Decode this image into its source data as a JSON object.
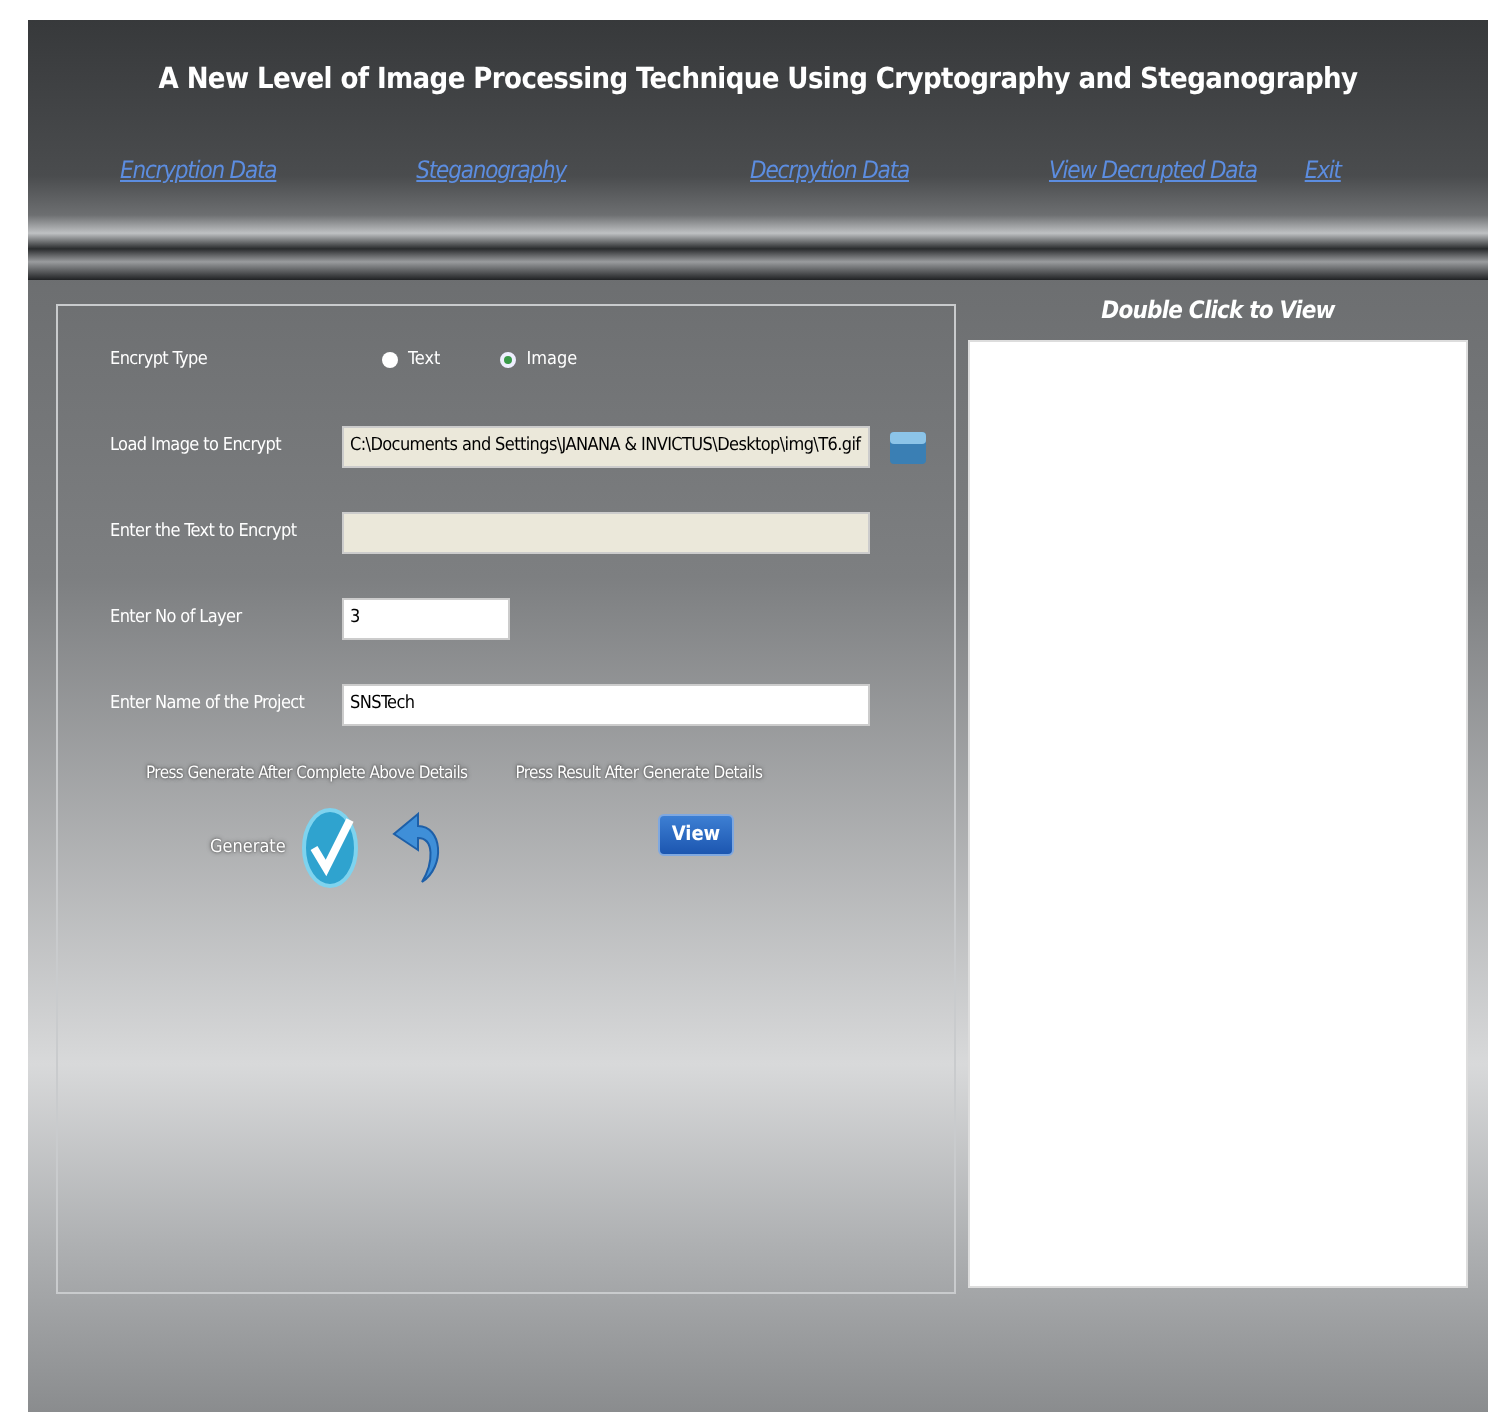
{
  "window": {
    "title": "A New Level of Image Processing Technique Using Cryptography and Steganography"
  },
  "menu": [
    {
      "label": "Encryption Data"
    },
    {
      "label": "Steganography"
    },
    {
      "label": "Decrpytion Data"
    },
    {
      "label": "View Decrupted Data"
    },
    {
      "label": "Exit"
    }
  ],
  "encrypt_type": {
    "label": "Encrypt Type",
    "options": [
      {
        "label": "Text",
        "selected": false
      },
      {
        "label": "Image",
        "selected": true
      }
    ]
  },
  "fields": [
    {
      "label": "Load Image to Encrypt",
      "value": "C:\\Documents and Settings\\JANANA & INVICTUS\\Desktop\\img\\T6.gif",
      "kind": "path"
    },
    {
      "label": "Enter the Text to Encrypt",
      "kind": "readonly"
    },
    {
      "label": "Enter No of Layer",
      "value": "3",
      "kind": "short"
    },
    {
      "label": "Enter Name of the Project",
      "value": "SNSTech",
      "kind": "long"
    }
  ],
  "generate_hint": "Press Generate After Complete Above Details",
  "result_hint": "Press Result After Generate Details",
  "generate_label": "Generate",
  "view_button": "View",
  "preview": {
    "title": "Double Click to View"
  }
}
